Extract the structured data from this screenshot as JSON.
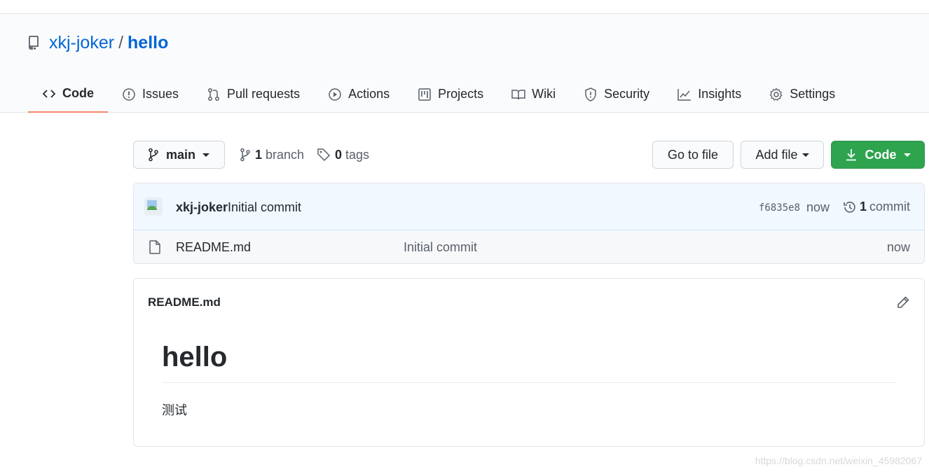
{
  "repo": {
    "owner": "xkj-joker",
    "slash": "/",
    "name": "hello"
  },
  "tabs": [
    {
      "label": "Code",
      "icon": "code-icon",
      "active": true
    },
    {
      "label": "Issues",
      "icon": "issue-icon"
    },
    {
      "label": "Pull requests",
      "icon": "pull-request-icon"
    },
    {
      "label": "Actions",
      "icon": "play-icon"
    },
    {
      "label": "Projects",
      "icon": "project-icon"
    },
    {
      "label": "Wiki",
      "icon": "book-icon"
    },
    {
      "label": "Security",
      "icon": "shield-icon"
    },
    {
      "label": "Insights",
      "icon": "graph-icon"
    },
    {
      "label": "Settings",
      "icon": "gear-icon"
    }
  ],
  "toolbar": {
    "branch": "main",
    "branch_count": "1",
    "branch_label": "branch",
    "tag_count": "0",
    "tag_label": "tags",
    "go_to_file": "Go to file",
    "add_file": "Add file",
    "code": "Code"
  },
  "commit": {
    "author": "xkj-joker",
    "message": "Initial commit",
    "sha": "f6835e8",
    "time": "now",
    "count": "1",
    "count_label": "commit"
  },
  "files": [
    {
      "name": "README.md",
      "commit_message": "Initial commit",
      "age": "now"
    }
  ],
  "readme": {
    "title": "README.md",
    "heading": "hello",
    "body": "测试"
  },
  "watermark": "https://blog.csdn.net/weixin_45982067",
  "colors": {
    "link": "#0366d6",
    "active_tab_underline": "#f9826c",
    "primary_button": "#2ea44f"
  }
}
